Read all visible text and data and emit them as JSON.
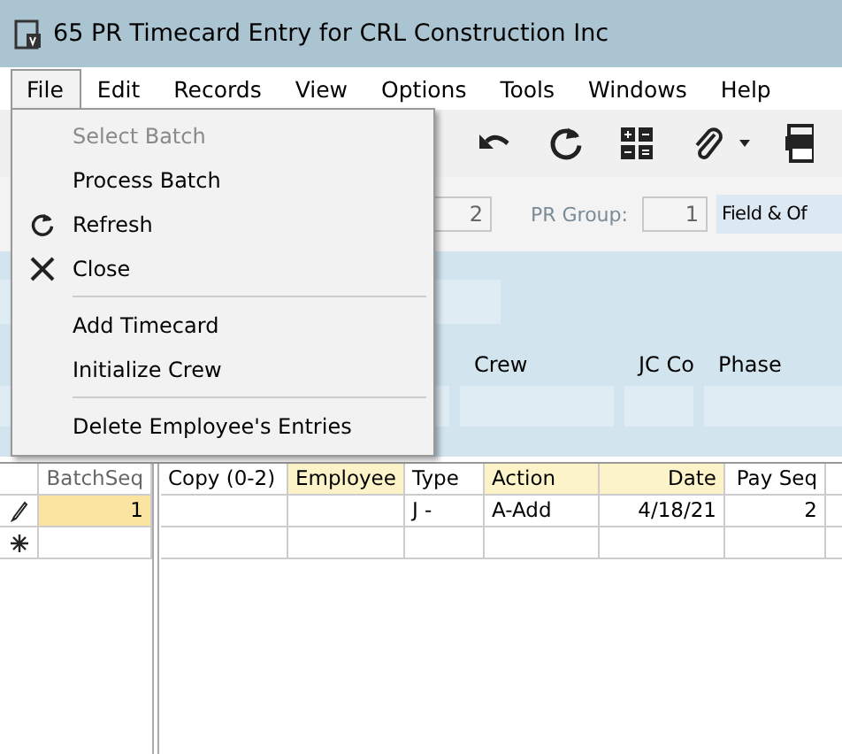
{
  "window": {
    "title": "65 PR Timecard Entry for CRL Construction Inc"
  },
  "menu_bar": [
    {
      "label": "File",
      "selected": true
    },
    {
      "label": "Edit",
      "selected": false
    },
    {
      "label": "Records",
      "selected": false
    },
    {
      "label": "View",
      "selected": false
    },
    {
      "label": "Options",
      "selected": false
    },
    {
      "label": "Tools",
      "selected": false
    },
    {
      "label": "Windows",
      "selected": false
    },
    {
      "label": "Help",
      "selected": false
    }
  ],
  "file_menu": [
    {
      "kind": "item",
      "label": "Select Batch",
      "disabled": true
    },
    {
      "kind": "item",
      "label": "Process Batch",
      "disabled": false
    },
    {
      "kind": "refresh",
      "label": "Refresh",
      "disabled": false
    },
    {
      "kind": "close",
      "label": "Close",
      "disabled": false
    },
    {
      "kind": "separator"
    },
    {
      "kind": "item",
      "label": "Add Timecard",
      "disabled": false
    },
    {
      "kind": "item",
      "label": "Initialize Crew",
      "disabled": false
    },
    {
      "kind": "separator"
    },
    {
      "kind": "item",
      "label": "Delete Employee's Entries",
      "disabled": false
    }
  ],
  "header": {
    "field_1": "2",
    "pr_group_label": "PR Group:",
    "pr_group": "1",
    "pr_group_description": "Field & Of"
  },
  "detail_labels": [
    "Crew",
    "JC Co",
    "Phase"
  ],
  "batch_grid": {
    "column": "BatchSeq",
    "rows": [
      {
        "kind": "editing",
        "value": "1",
        "selected": true
      },
      {
        "kind": "new",
        "value": "",
        "selected": false
      }
    ]
  },
  "entry_grid": {
    "columns": [
      {
        "label": "Copy (0-2)",
        "required": false
      },
      {
        "label": "Employee",
        "required": true
      },
      {
        "label": "Type",
        "required": false
      },
      {
        "label": "Action",
        "required": true
      },
      {
        "label": "Date",
        "required": true
      },
      {
        "label": "Pay Seq",
        "required": false
      }
    ],
    "rows": [
      [
        "",
        "",
        "J -",
        "A-Add",
        "4/18/21",
        "2"
      ],
      [
        "",
        "",
        "",
        "",
        "",
        ""
      ]
    ]
  }
}
